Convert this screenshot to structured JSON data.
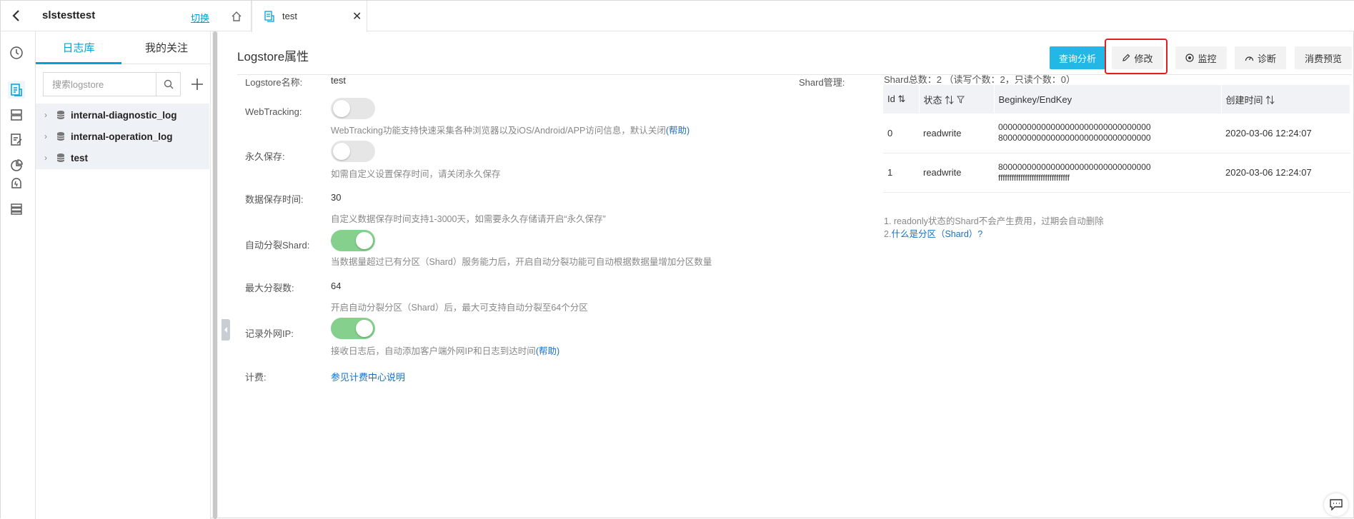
{
  "project": {
    "name": "slstesttest",
    "switch_label": "切换"
  },
  "panel": {
    "tabs": [
      "日志库",
      "我的关注"
    ],
    "search_placeholder": "搜索logstore",
    "logstores": [
      "internal-diagnostic_log",
      "internal-operation_log",
      "test"
    ]
  },
  "tabbar": {
    "active_tab": "test"
  },
  "header": {
    "title": "Logstore属性",
    "buttons": {
      "query": "查询分析",
      "edit": "修改",
      "monitor": "监控",
      "diagnose": "诊断",
      "consume": "消费预览"
    }
  },
  "props": {
    "name_label": "Logstore名称:",
    "name_value": "test",
    "webtracking_label": "WebTracking:",
    "webtracking_hint": "WebTracking功能支持快速采集各种浏览器以及iOS/Android/APP访问信息，默认关闭",
    "webtracking_help": "(帮助)",
    "permanent_label": "永久保存:",
    "permanent_hint": "如需自定义设置保存时间，请关闭永久保存",
    "retention_label": "数据保存时间:",
    "retention_value": "30",
    "retention_hint": "自定义数据保存时间支持1-3000天，如需要永久存储请开启“永久保存”",
    "autosplit_label": "自动分裂Shard:",
    "autosplit_hint": "当数据量超过已有分区（Shard）服务能力后，开启自动分裂功能可自动根据数据量增加分区数量",
    "maxsplit_label": "最大分裂数:",
    "maxsplit_value": "64",
    "maxsplit_hint": "开启自动分裂分区（Shard）后，最大可支持自动分裂至64个分区",
    "recordip_label": "记录外网IP:",
    "recordip_hint": "接收日志后，自动添加客户端外网IP和日志到达时间",
    "recordip_help": "(帮助)",
    "billing_label": "计费:",
    "billing_link": "参见计费中心说明"
  },
  "toggles": {
    "webtracking": false,
    "permanent": false,
    "autosplit": true,
    "recordip": true
  },
  "shard": {
    "label": "Shard管理:",
    "total": "Shard总数：2 （读写个数：2，只读个数：0）",
    "columns": [
      "Id",
      "状态",
      "Beginkey/EndKey",
      "创建时间"
    ],
    "rows": [
      {
        "id": "0",
        "status": "readwrite",
        "begin": "00000000000000000000000000000000",
        "end": "80000000000000000000000000000000",
        "time": "2020-03-06 12:24:07"
      },
      {
        "id": "1",
        "status": "readwrite",
        "begin": "80000000000000000000000000000000",
        "end": "ffffffffffffffffffffffffffffffff",
        "time": "2020-03-06 12:24:07"
      }
    ],
    "note1": "1. readonly状态的Shard不会产生费用，过期会自动删除",
    "note2_prefix": "2.",
    "note2_link": "什么是分区（Shard）?"
  },
  "icons": [
    "back-icon",
    "clock-icon",
    "logstore-icon",
    "server-icon",
    "edit-doc-icon",
    "chart-icon",
    "alert-icon",
    "list-icon",
    "search-icon",
    "plus-icon",
    "database-icon",
    "home-icon",
    "close-icon",
    "pencil-icon",
    "monitor-icon",
    "gauge-icon",
    "chat-icon"
  ],
  "colors": {
    "accent": "#00a1d6",
    "primary_button": "#23b7e5",
    "toggle_on": "#84d08c",
    "highlight": "#e02020",
    "link": "#1a6fc4"
  }
}
